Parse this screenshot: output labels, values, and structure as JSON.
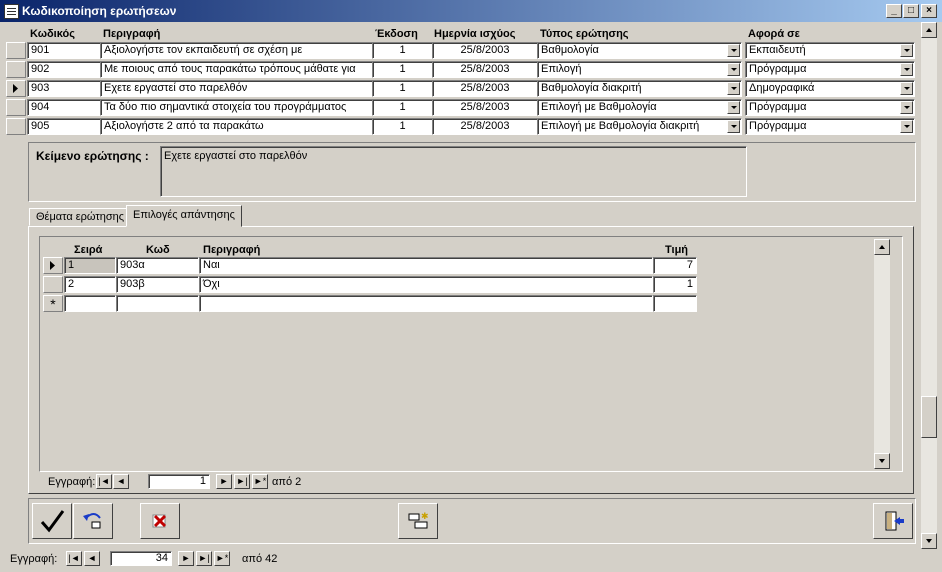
{
  "window": {
    "title": "Κωδικοποίηση ερωτήσεων",
    "minimize": "_",
    "maximize": "□",
    "close": "×"
  },
  "grid": {
    "headers": {
      "code": "Κωδικός",
      "desc": "Περιγραφή",
      "version": "Έκδοση",
      "date": "Ημερνία ισχύος",
      "type": "Τύπος ερώτησης",
      "about": "Αφορά σε"
    },
    "rows": [
      {
        "code": "901",
        "desc": "Αξιολογήστε τον εκπαιδευτή σε σχέση με",
        "version": "1",
        "date": "25/8/2003",
        "type": "Βαθμολογία",
        "about": "Εκπαιδευτή",
        "current": false
      },
      {
        "code": "902",
        "desc": "Με ποιους από τους παρακάτω τρόπους μάθατε για",
        "version": "1",
        "date": "25/8/2003",
        "type": "Επιλογή",
        "about": "Πρόγραμμα",
        "current": false
      },
      {
        "code": "903",
        "desc": "Εχετε εργαστεί στο παρελθόν",
        "version": "1",
        "date": "25/8/2003",
        "type": "Βαθμολογία διακριτή",
        "about": "Δημογραφικά",
        "current": true
      },
      {
        "code": "904",
        "desc": "Τα δύο πιο σημαντικά στοιχεία του προγράμματος",
        "version": "1",
        "date": "25/8/2003",
        "type": "Επιλογή με Βαθμολογία",
        "about": "Πρόγραμμα",
        "current": false
      },
      {
        "code": "905",
        "desc": "Αξιολογήστε 2 από τα παρακάτω",
        "version": "1",
        "date": "25/8/2003",
        "type": "Επιλογή με Βαθμολογία διακριτή",
        "about": "Πρόγραμμα",
        "current": false
      }
    ]
  },
  "question_text": {
    "label": "Κείμενο ερώτησης :",
    "value": "Εχετε εργαστεί στο παρελθόν"
  },
  "tabs": [
    {
      "label": "Θέματα ερώτησης",
      "active": false
    },
    {
      "label": "Επιλογές απάντησης",
      "active": true
    }
  ],
  "subgrid": {
    "headers": {
      "order": "Σειρά",
      "code": "Κωδ",
      "desc": "Περιγραφή",
      "value": "Τιμή"
    },
    "rows": [
      {
        "order": "1",
        "code": "903α",
        "desc": "Ναι",
        "value": "7"
      },
      {
        "order": "2",
        "code": "903β",
        "desc": "Όχι",
        "value": "1"
      }
    ],
    "new_row_marker": "*"
  },
  "subnav": {
    "label": "Εγγραφή:",
    "current": "1",
    "total": "από 2"
  },
  "mainnav": {
    "label": "Εγγραφή:",
    "current": "34",
    "total": "από 42"
  },
  "icons": {
    "save": "check-icon",
    "undo": "undo-icon",
    "delete": "delete-icon",
    "new": "new-record-icon",
    "exit": "exit-icon"
  }
}
